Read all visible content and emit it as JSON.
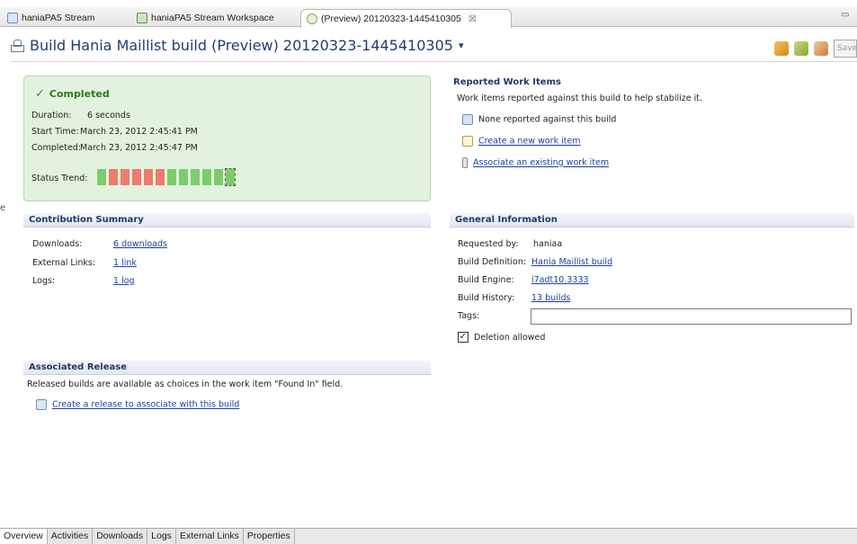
{
  "tabs": [
    {
      "label": "haniaPA5 Stream",
      "icon": "stream-icon"
    },
    {
      "label": "haniaPA5 Stream Workspace",
      "icon": "workspace-icon"
    },
    {
      "label": "(Preview) 20120323-1445410305",
      "icon": "build-icon",
      "close": "☒"
    }
  ],
  "title": "Build Hania Maillist build (Preview) 20120323-1445410305",
  "title_caret": "▾",
  "toolbar": {
    "save_label": "Save"
  },
  "status": {
    "state": "Completed",
    "duration_label": "Duration:",
    "duration": "6 seconds",
    "start_label": "Start Time:",
    "start": "March 23, 2012 2:45:41 PM",
    "completed_label": "Completed:",
    "completed": "March 23, 2012 2:45:47 PM",
    "trend_label": "Status Trend:",
    "trend": [
      "green",
      "red",
      "red",
      "red",
      "red",
      "red",
      "green",
      "green",
      "green",
      "green",
      "green",
      "green"
    ]
  },
  "contribution": {
    "header": "Contribution Summary",
    "rows": [
      {
        "label": "Downloads:",
        "value": "6 downloads"
      },
      {
        "label": "External Links:",
        "value": "1 link"
      },
      {
        "label": "Logs:",
        "value": "1 log"
      }
    ]
  },
  "release": {
    "header": "Associated Release",
    "description": "Released builds are available as choices in the work item \"Found In\" field.",
    "link": "Create a release to associate with this build"
  },
  "work_items": {
    "header": "Reported Work Items",
    "description": "Work items reported against this build to help stabilize it.",
    "none": "None reported against this build",
    "create": "Create a new work item",
    "associate": "Associate an existing work item"
  },
  "general": {
    "header": "General Information",
    "requested_label": "Requested by:",
    "requested": "haniaa",
    "definition_label": "Build Definition:",
    "definition": "Hania Maillist build",
    "engine_label": "Build Engine:",
    "engine": "i7adt10.3333",
    "history_label": "Build History:",
    "history": "13 builds",
    "tags_label": "Tags:",
    "tags_value": "",
    "deletion_label": "Deletion allowed",
    "deletion_checked": true
  },
  "bottom_tabs": [
    "Overview",
    "Activities",
    "Downloads",
    "Logs",
    "External Links",
    "Properties"
  ],
  "left_edge_char": "e"
}
